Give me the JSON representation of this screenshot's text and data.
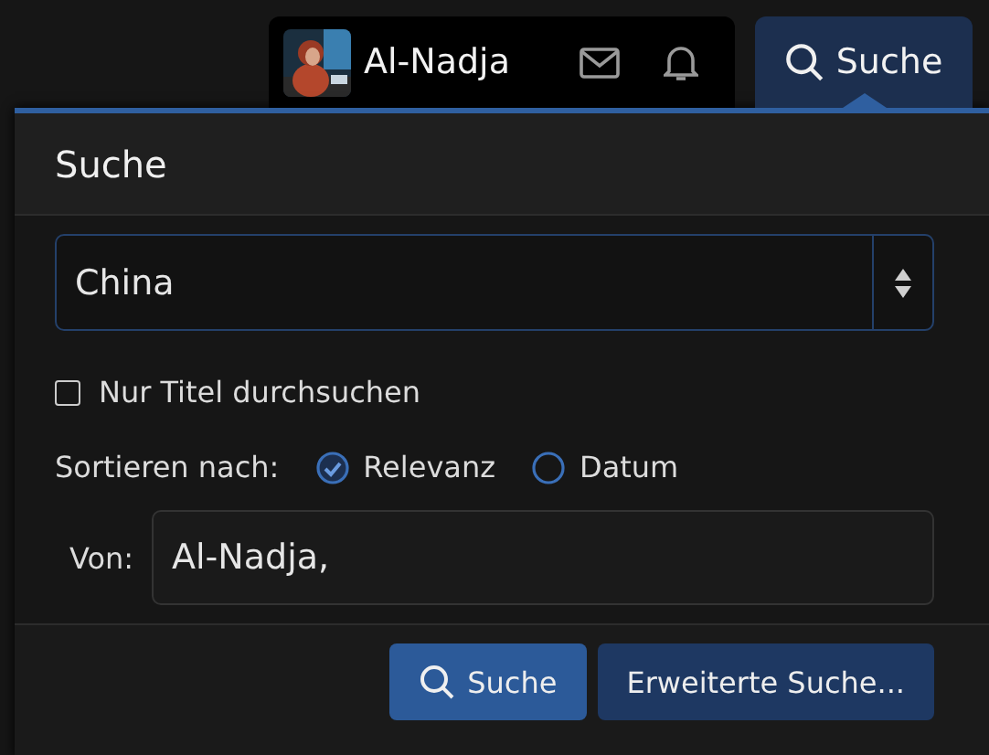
{
  "header": {
    "user": {
      "name": "Al-Nadja"
    },
    "search_tab": {
      "label": "Suche",
      "selected": true
    }
  },
  "search_popup": {
    "title": "Suche",
    "query": {
      "value": "China"
    },
    "title_only": {
      "label": "Nur Titel durchsuchen",
      "checked": false
    },
    "sort": {
      "label": "Sortieren nach:",
      "options": [
        {
          "label": "Relevanz",
          "selected": true
        },
        {
          "label": "Datum",
          "selected": false
        }
      ]
    },
    "from": {
      "label": "Von:",
      "value": "Al-Nadja,"
    },
    "buttons": [
      {
        "kind": "primary",
        "label": "Suche"
      },
      {
        "kind": "secondary",
        "label": "Erweiterte Suche..."
      }
    ]
  }
}
